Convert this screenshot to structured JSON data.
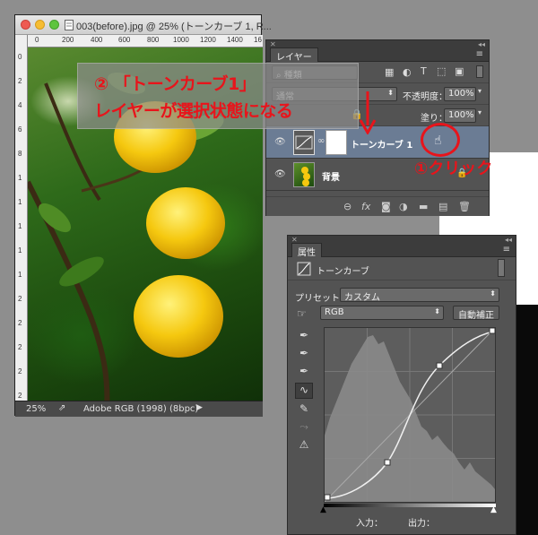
{
  "document": {
    "title": "003(before).jpg @ 25% (トーンカーブ 1, R...",
    "ruler_top_ticks": [
      "0",
      "200",
      "400",
      "600",
      "800",
      "1000",
      "1200",
      "1400",
      "16"
    ],
    "ruler_left_ticks": [
      "0",
      "2",
      "4",
      "6",
      "8",
      "1",
      "1",
      "1",
      "1",
      "1",
      "2",
      "2",
      "2",
      "2",
      "2"
    ],
    "zoom": "25%",
    "profile": "Adobe RGB (1998) (8bpc)"
  },
  "layers_panel": {
    "tab_label": "レイヤー",
    "filter_label": "種類",
    "blend_mode": "通常",
    "opacity_label": "不透明度：",
    "opacity_value": "100%",
    "fill_label": "塗り：",
    "fill_value": "100%",
    "layers": [
      {
        "name": "トーンカーブ 1",
        "selected": true
      },
      {
        "name": "背景",
        "selected": false
      }
    ]
  },
  "properties_panel": {
    "tab_label": "属性",
    "adjustment_name": "トーンカーブ",
    "preset_label": "プリセット：",
    "preset_value": "カスタム",
    "channel_value": "RGB",
    "auto_button": "自動補正",
    "input_label": "入力：",
    "output_label": "出力："
  },
  "annotations": {
    "line1": "② 「トーンカーブ1」",
    "line2": "レイヤーが選択状態になる",
    "click": "①クリック",
    "color": "#e8141b"
  }
}
